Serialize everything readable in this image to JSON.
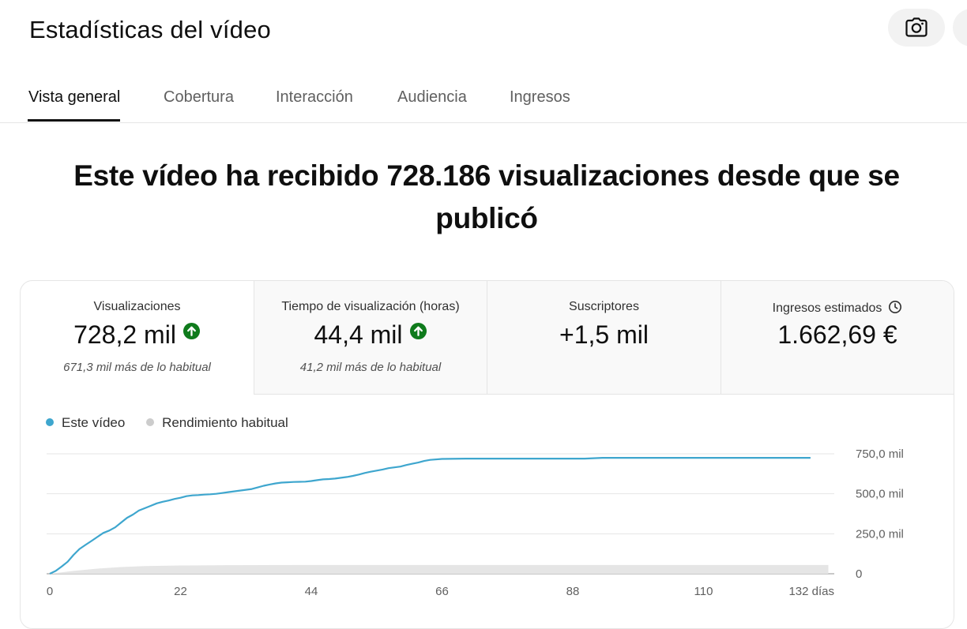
{
  "header": {
    "title": "Estadísticas del vídeo",
    "camera_icon": "camera-icon"
  },
  "tabs": [
    {
      "label": "Vista general",
      "active": true
    },
    {
      "label": "Cobertura",
      "active": false
    },
    {
      "label": "Interacción",
      "active": false
    },
    {
      "label": "Audiencia",
      "active": false
    },
    {
      "label": "Ingresos",
      "active": false
    }
  ],
  "headline": "Este vídeo ha recibido 728.186 visualizaciones desde que se publicó",
  "metrics": [
    {
      "label": "Visualizaciones",
      "value": "728,2 mil",
      "sub": "671,3 mil más de lo habitual",
      "trend_icon": "arrow-up-circle-icon"
    },
    {
      "label": "Tiempo de visualización (horas)",
      "value": "44,4 mil",
      "sub": "41,2 mil más de lo habitual",
      "trend_icon": "arrow-up-circle-icon"
    },
    {
      "label": "Suscriptores",
      "value": "+1,5 mil",
      "sub": ""
    },
    {
      "label": "Ingresos estimados",
      "value": "1.662,69 €",
      "sub": "",
      "info_icon": "clock-icon"
    }
  ],
  "colors": {
    "series_this_video": "#3ea6ce",
    "series_typical": "#e5e5e5",
    "trend_up": "#0f7b1c"
  },
  "chart_data": {
    "type": "line",
    "series": [
      {
        "name": "Este vídeo",
        "x": [
          0,
          1,
          2,
          3,
          4,
          5,
          6,
          7,
          8,
          9,
          10,
          11,
          12,
          13,
          14,
          15,
          16,
          17,
          18,
          19,
          20,
          21,
          22,
          23,
          24,
          25,
          26,
          27,
          28,
          29,
          30,
          31,
          32,
          33,
          34,
          35,
          36,
          37,
          38,
          39,
          40,
          41,
          42,
          43,
          44,
          45,
          46,
          47,
          48,
          49,
          50,
          51,
          52,
          53,
          54,
          55,
          56,
          57,
          58,
          59,
          60,
          61,
          62,
          63,
          64,
          66,
          70,
          80,
          90,
          93,
          100,
          110,
          120,
          128
        ],
        "values": [
          0,
          18,
          45,
          75,
          118,
          155,
          180,
          205,
          230,
          255,
          270,
          290,
          320,
          350,
          370,
          395,
          410,
          425,
          440,
          450,
          458,
          468,
          475,
          485,
          490,
          492,
          495,
          497,
          500,
          505,
          510,
          515,
          520,
          525,
          530,
          540,
          550,
          558,
          565,
          570,
          572,
          574,
          575,
          576,
          580,
          585,
          590,
          592,
          595,
          600,
          605,
          612,
          620,
          630,
          638,
          645,
          652,
          660,
          665,
          670,
          680,
          688,
          695,
          705,
          712,
          718,
          720,
          720,
          720,
          725,
          725,
          725,
          725,
          725
        ]
      },
      {
        "name": "Rendimiento habitual",
        "x": [
          0,
          4,
          8,
          12,
          16,
          22,
          30,
          44,
          66,
          88,
          110,
          131
        ],
        "values": [
          0,
          18,
          32,
          42,
          48,
          52,
          54,
          55,
          55,
          55,
          55,
          55
        ]
      }
    ],
    "x_ticks": [
      "0",
      "22",
      "44",
      "66",
      "88",
      "110",
      "132 días"
    ],
    "x_tick_values": [
      0,
      22,
      44,
      66,
      88,
      110,
      132
    ],
    "y_ticks": [
      "0",
      "250,0 mil",
      "500,0 mil",
      "750,0 mil"
    ],
    "y_tick_values": [
      0,
      250,
      500,
      750
    ],
    "xlim": [
      0,
      132
    ],
    "ylim": [
      0,
      750
    ],
    "grid": true,
    "legend_position": "top-left"
  }
}
